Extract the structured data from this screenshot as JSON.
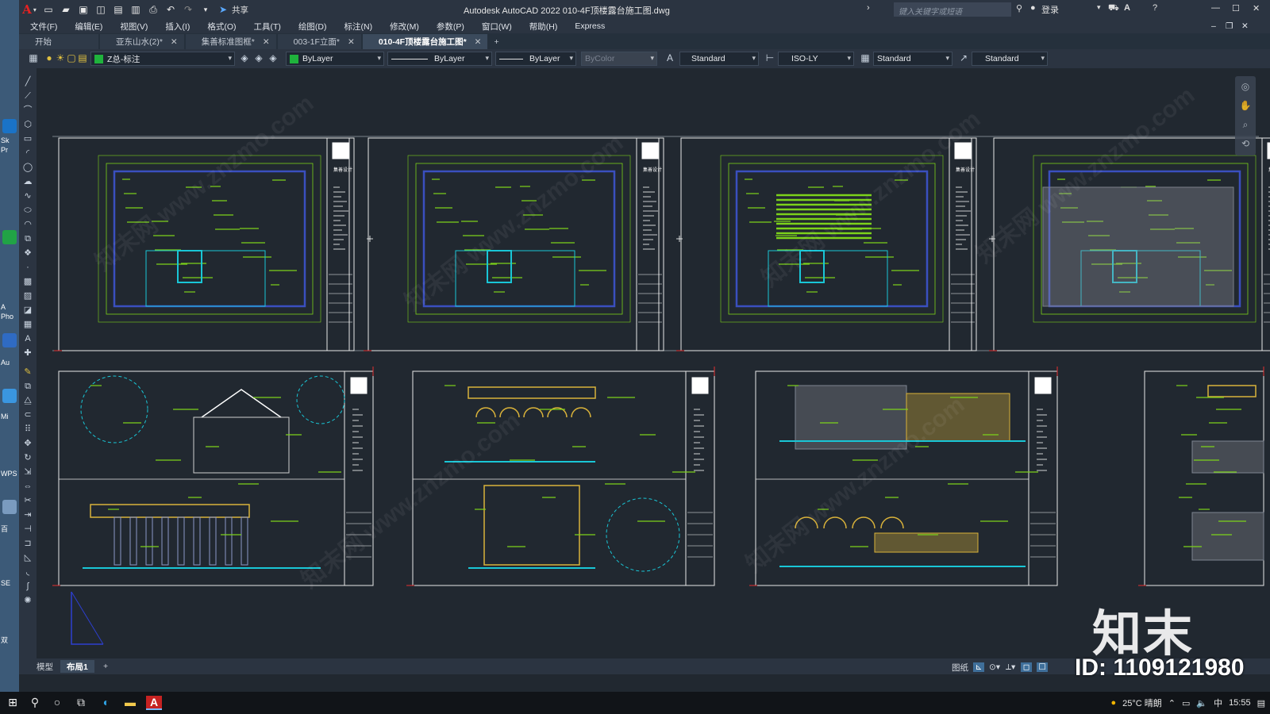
{
  "window": {
    "title": "Autodesk AutoCAD 2022    010-4F顶楼露台施工图.dwg",
    "app_logo": "A",
    "search_placeholder": "键入关键字或短语",
    "share_label": "共享",
    "login_label": "登录"
  },
  "menu": [
    "文件(F)",
    "编辑(E)",
    "视图(V)",
    "插入(I)",
    "格式(O)",
    "工具(T)",
    "绘图(D)",
    "标注(N)",
    "修改(M)",
    "参数(P)",
    "窗口(W)",
    "帮助(H)",
    "Express"
  ],
  "file_tabs": [
    {
      "label": "开始",
      "closable": false
    },
    {
      "label": "亚东山水(2)*",
      "closable": true
    },
    {
      "label": "集善标准图框*",
      "closable": true
    },
    {
      "label": "003-1F立面*",
      "closable": true
    },
    {
      "label": "010-4F顶楼露台施工图*",
      "closable": true,
      "active": true
    }
  ],
  "properties": {
    "layer": "Z总-标注",
    "color": "ByLayer",
    "linetype": "ByLayer",
    "lineweight": "ByLayer",
    "plotstyle": "ByColor",
    "text_style": "Standard",
    "dim_style": "ISO-LY",
    "table_style": "Standard",
    "multileader_style": "Standard"
  },
  "layout_tabs": [
    {
      "label": "模型",
      "active": false
    },
    {
      "label": "布局1",
      "active": true
    },
    {
      "label": "+",
      "active": false
    }
  ],
  "status": {
    "paper_label": "图纸"
  },
  "watermark": {
    "logo_text": "知末",
    "id_text": "ID: 1109121980",
    "diag_text": "知末网 www.znzmo.com"
  },
  "taskbar": {
    "weather": "25°C 晴朗",
    "ime": "中",
    "time": "15:55"
  },
  "desktop_labels": [
    "Sk",
    "Pr",
    "A",
    "Pho",
    "Au",
    "Mi",
    "WPS",
    "百",
    "SE",
    "双"
  ],
  "sheet_stamp_text": "集善设计",
  "colors": {
    "accent_green": "#7cd21a",
    "accent_cyan": "#19c6d6",
    "accent_yellow": "#d9b23a",
    "wall_blue": "#3a4fbf",
    "frame_white": "#e8e8e8"
  }
}
